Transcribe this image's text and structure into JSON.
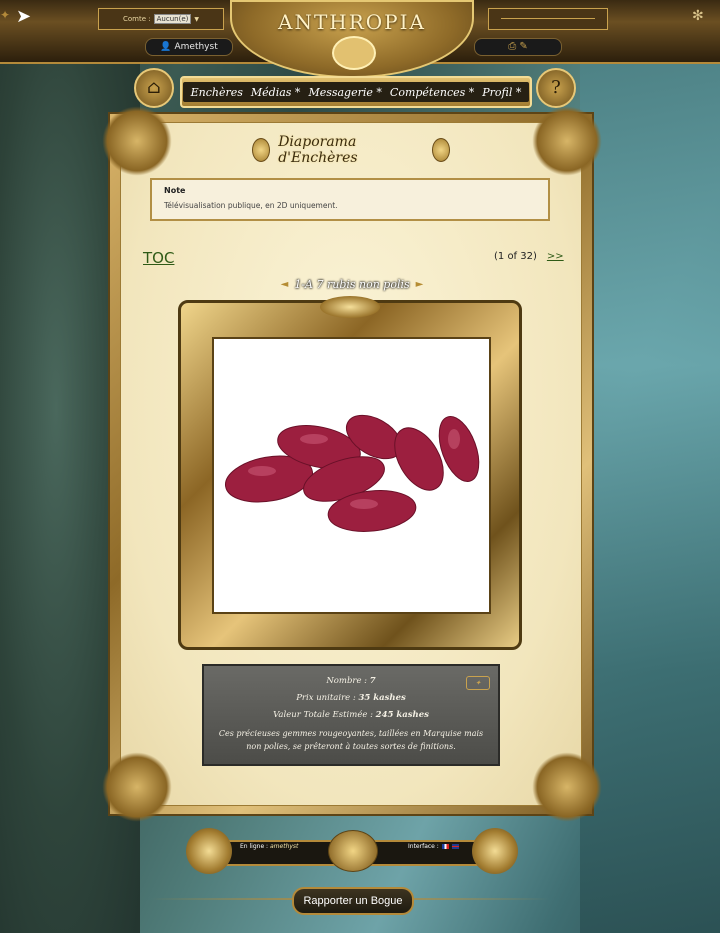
{
  "header": {
    "account_label": "Comte :",
    "account_select": "Aucun(e)",
    "username": "Amethyst",
    "logo_text": "ANTHROPIA"
  },
  "nav": {
    "items": [
      "Enchères",
      "Médias *",
      "Messagerie *",
      "Compétences *",
      "Profil *"
    ],
    "help_label": "?"
  },
  "panel": {
    "title": "Diaporama d'Enchères",
    "note_title": "Note",
    "note_text": "Télévisualisation publique, en 2D uniquement.",
    "toc": "TOC",
    "pager_position": "(1 of 32)",
    "pager_next": ">>",
    "item_title": "1-A   7 rubis non polis"
  },
  "info": {
    "count_label": "Nombre :",
    "count_value": "7",
    "unit_price_label": "Prix unitaire :",
    "unit_price_value": "35 kashes",
    "total_label": "Valeur Totale Estimée :",
    "total_value": "245 kashes",
    "description": "Ces précieuses gemmes rougeoyantes, taillées en Marquise mais non polies, se prêteront à toutes sortes de finitions."
  },
  "footer": {
    "online_label": "En ligne :",
    "online_user": "amethyst",
    "interface_label": "Interface :",
    "report_bug": "Rapporter un Bogue"
  }
}
